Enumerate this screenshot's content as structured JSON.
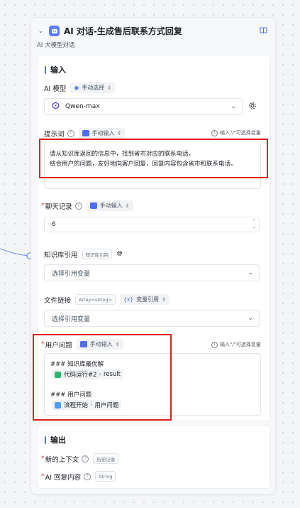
{
  "node": {
    "title": "AI 对话-生成售后联系方式回复",
    "subtitle": "AI 大模型对话"
  },
  "input_section": {
    "title": "输入",
    "model": {
      "label": "AI 模型",
      "source": "手动选择",
      "value": "Qwen-max"
    },
    "prompt": {
      "label": "提示词",
      "source": "手动输入",
      "hint": "输入\"/\"可选择变量",
      "lines": [
        "请从知识库返回的信息中，找到省市对应的联系电话。",
        "结合用户的问题，友好地向客户回复，回复内容包含省市和联系电话。"
      ]
    },
    "history": {
      "label": "聊天记录",
      "source": "手动输入",
      "value": "6"
    },
    "knowledge": {
      "label": "知识库引用",
      "tag": "知识库引用",
      "placeholder": "选择引用变量"
    },
    "file_link": {
      "label": "文件链接",
      "type_tag": "Array<string>",
      "source": "变量引用",
      "placeholder": "选择引用变量"
    },
    "user_question": {
      "label": "用户问题",
      "source": "手动输入",
      "hint": "输入\"/\"可选择变量",
      "line1": "### 知识库最优解",
      "ref1_node": "代码运行#2",
      "ref1_var": "result",
      "line2": "### 用户问题",
      "ref2_node": "流程开始",
      "ref2_var": "用户问题"
    }
  },
  "output_section": {
    "title": "输出",
    "context_label": "新的上下文",
    "context_tag": "历史记录",
    "reply_label": "AI 回复内容",
    "reply_tag": "String"
  },
  "colors": {
    "accent": "#4e6ef2",
    "highlight": "#e02020",
    "required": "#e5484d"
  }
}
